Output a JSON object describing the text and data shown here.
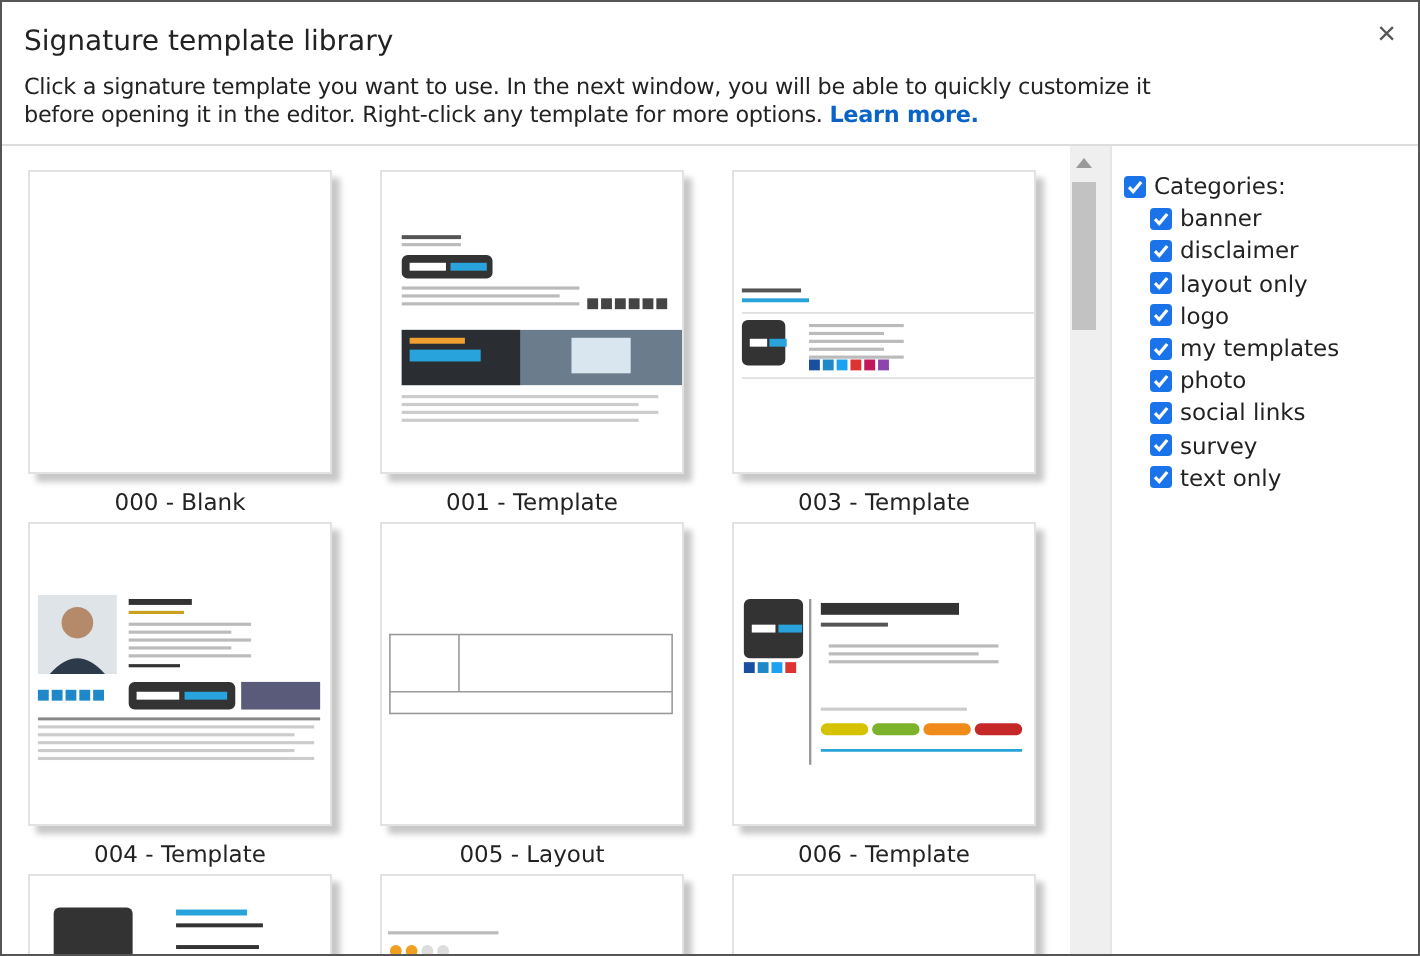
{
  "window": {
    "title": "Signature template library",
    "close": "×"
  },
  "description": {
    "text": "Click a signature template you want to use. In the next window, you will be able to quickly customize it before opening it in the editor. Right-click any template for more options.",
    "link": "Learn more."
  },
  "templates": [
    {
      "label": "000 - Blank",
      "kind": "blank"
    },
    {
      "label": "001 - Template",
      "kind": "banner"
    },
    {
      "label": "003 - Template",
      "kind": "logo"
    },
    {
      "label": "004 - Template",
      "kind": "photo"
    },
    {
      "label": "005 - Layout",
      "kind": "layout"
    },
    {
      "label": "006 - Template",
      "kind": "survey"
    },
    {
      "kind": "company"
    },
    {
      "kind": "rating"
    },
    {
      "kind": "blank"
    }
  ],
  "categories": {
    "label": "Categories:",
    "checked": true,
    "items": [
      {
        "label": "banner",
        "checked": true
      },
      {
        "label": "disclaimer",
        "checked": true
      },
      {
        "label": "layout only",
        "checked": true
      },
      {
        "label": "logo",
        "checked": true
      },
      {
        "label": "my templates",
        "checked": true
      },
      {
        "label": "photo",
        "checked": true
      },
      {
        "label": "social links",
        "checked": true
      },
      {
        "label": "survey",
        "checked": true
      },
      {
        "label": "text only",
        "checked": true
      }
    ]
  }
}
